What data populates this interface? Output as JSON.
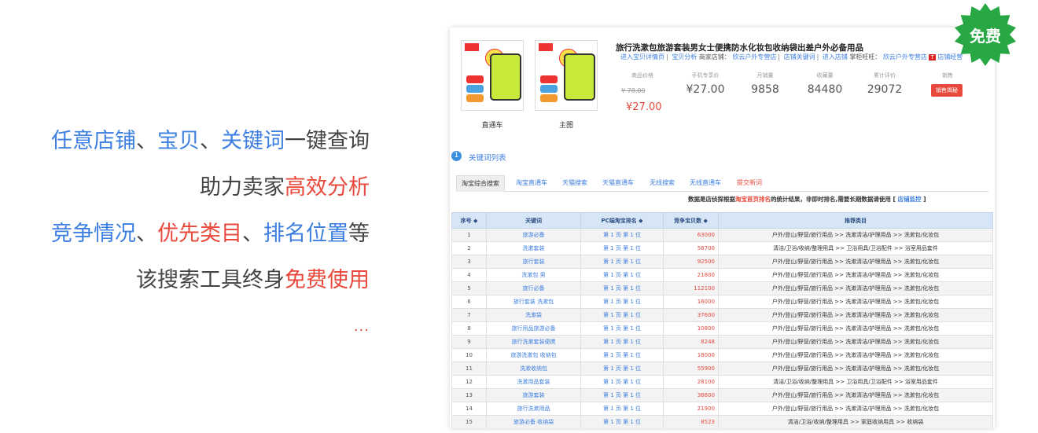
{
  "promo": {
    "line1": [
      {
        "text": "任意店铺",
        "color": "blue"
      },
      {
        "text": "、",
        "color": "plain"
      },
      {
        "text": "宝贝",
        "color": "blue"
      },
      {
        "text": "、",
        "color": "plain"
      },
      {
        "text": "关键词",
        "color": "blue"
      },
      {
        "text": "一键查询",
        "color": "plain"
      }
    ],
    "line2": [
      {
        "text": "助力卖家",
        "color": "plain"
      },
      {
        "text": "高效分析",
        "color": "red"
      }
    ],
    "line3": [
      {
        "text": "竞争情况",
        "color": "blue"
      },
      {
        "text": "、",
        "color": "plain"
      },
      {
        "text": "优先类目",
        "color": "red"
      },
      {
        "text": "、",
        "color": "plain"
      },
      {
        "text": "排名位置",
        "color": "blue"
      },
      {
        "text": "等",
        "color": "plain"
      }
    ],
    "line4": [
      {
        "text": "该搜索工具终身",
        "color": "plain"
      },
      {
        "text": "免费使用",
        "color": "red"
      }
    ],
    "ellipsis": "..."
  },
  "badge": {
    "label": "免费",
    "color": "#27a844"
  },
  "product": {
    "title": "旅行洗漱包旅游套装男女士便携防水化妆包收纳袋出差户外必备用品",
    "links": [
      "进入宝贝详情页",
      "宝贝分析",
      "商家店铺：",
      "欣云户外专营店",
      "店铺关键词",
      "进入店铺",
      "掌柜旺旺：",
      "欣云户外专营店",
      "店铺经营"
    ],
    "thumb_captions": [
      "直通车",
      "主图"
    ],
    "stats": [
      {
        "label": "商品价格",
        "value": ""
      },
      {
        "label": "手机专享价",
        "value": "¥27.00"
      },
      {
        "label": "月销量",
        "value": "9858"
      },
      {
        "label": "收藏量",
        "value": "84480"
      },
      {
        "label": "累计评价",
        "value": "29072"
      },
      {
        "label": "销售",
        "value": ""
      }
    ],
    "old_price": "¥ 78.00",
    "new_price": "¥27.00",
    "sales_button": "销售揭秘"
  },
  "section": {
    "number": "1",
    "title": "关键词列表"
  },
  "tabs": [
    "淘宝综合搜索",
    "淘宝直通车",
    "天猫搜索",
    "天猫直通车",
    "无线搜索",
    "无线直通车",
    "提交新词"
  ],
  "notice": {
    "pre": "数据是店侦探根据",
    "red": "淘宝首页排名",
    "mid": "的统计结果，非即时排名,需要长期数据请使用 [ ",
    "link": "店铺监控",
    "post": " ]"
  },
  "table": {
    "headers": [
      "序号 ◆",
      "关键词",
      "PC端淘宝排名 ◆",
      "竞争宝贝数 ◆",
      "推荐类目"
    ],
    "rows": [
      [
        "1",
        "旅游必备",
        "第 1 页 第 1 位",
        "63000",
        "户外/登山/野营/旅行用品 >> 洗漱清洁/护理用品 >> 洗漱包/化妆包"
      ],
      [
        "2",
        "洗漱套装",
        "第 1 页 第 1 位",
        "58700",
        "清洁/卫浴/收纳/整理用具 >> 卫浴用具/卫浴配件 >> 浴室用品套件"
      ],
      [
        "3",
        "旅行套装",
        "第 1 页 第 1 位",
        "92500",
        "户外/登山/野营/旅行用品 >> 洗漱清洁/护理用品 >> 洗漱包/化妆包"
      ],
      [
        "4",
        "洗漱包 男",
        "第 1 页 第 1 位",
        "21800",
        "户外/登山/野营/旅行用品 >> 洗漱清洁/护理用品 >> 洗漱包/化妆包"
      ],
      [
        "5",
        "旅行必备",
        "第 1 页 第 1 位",
        "112100",
        "户外/登山/野营/旅行用品 >> 洗漱清洁/护理用品 >> 洗漱包/化妆包"
      ],
      [
        "6",
        "旅行套装 洗漱包",
        "第 1 页 第 1 位",
        "16000",
        "户外/登山/野营/旅行用品 >> 洗漱清洁/护理用品 >> 洗漱包/化妆包"
      ],
      [
        "7",
        "洗漱袋",
        "第 1 页 第 1 位",
        "37600",
        "户外/登山/野营/旅行用品 >> 洗漱清洁/护理用品 >> 洗漱包/化妆包"
      ],
      [
        "8",
        "旅行用品旅游必备",
        "第 1 页 第 1 位",
        "10800",
        "户外/登山/野营/旅行用品 >> 洗漱清洁/护理用品 >> 洗漱包/化妆包"
      ],
      [
        "9",
        "旅行洗漱套装便携",
        "第 1 页 第 1 位",
        "8248",
        "户外/登山/野营/旅行用品 >> 洗漱清洁/护理用品 >> 洗漱包/化妆包"
      ],
      [
        "10",
        "旅游洗漱包 收纳包",
        "第 1 页 第 1 位",
        "18000",
        "户外/登山/野营/旅行用品 >> 洗漱清洁/护理用品 >> 洗漱包/化妆包"
      ],
      [
        "11",
        "洗漱收纳包",
        "第 1 页 第 1 位",
        "55900",
        "户外/登山/野营/旅行用品 >> 洗漱清洁/护理用品 >> 洗漱包/化妆包"
      ],
      [
        "12",
        "洗漱用品套装",
        "第 1 页 第 1 位",
        "28100",
        "清洁/卫浴/收纳/整理用具 >> 卫浴用具/卫浴配件 >> 浴室用品套件"
      ],
      [
        "13",
        "旅游套装",
        "第 1 页 第 1 位",
        "36600",
        "户外/登山/野营/旅行用品 >> 洗漱清洁/护理用品 >> 洗漱包/化妆包"
      ],
      [
        "14",
        "旅行洗漱用品",
        "第 1 页 第 1 位",
        "21900",
        "户外/登山/野营/旅行用品 >> 洗漱清洁/护理用品 >> 洗漱包/化妆包"
      ],
      [
        "15",
        "旅游必备 收纳袋",
        "第 1 页 第 1 位",
        "8523",
        "清洁/卫浴/收纳/整理用具 >> 家庭收纳用具 >> 收纳袋"
      ]
    ]
  }
}
